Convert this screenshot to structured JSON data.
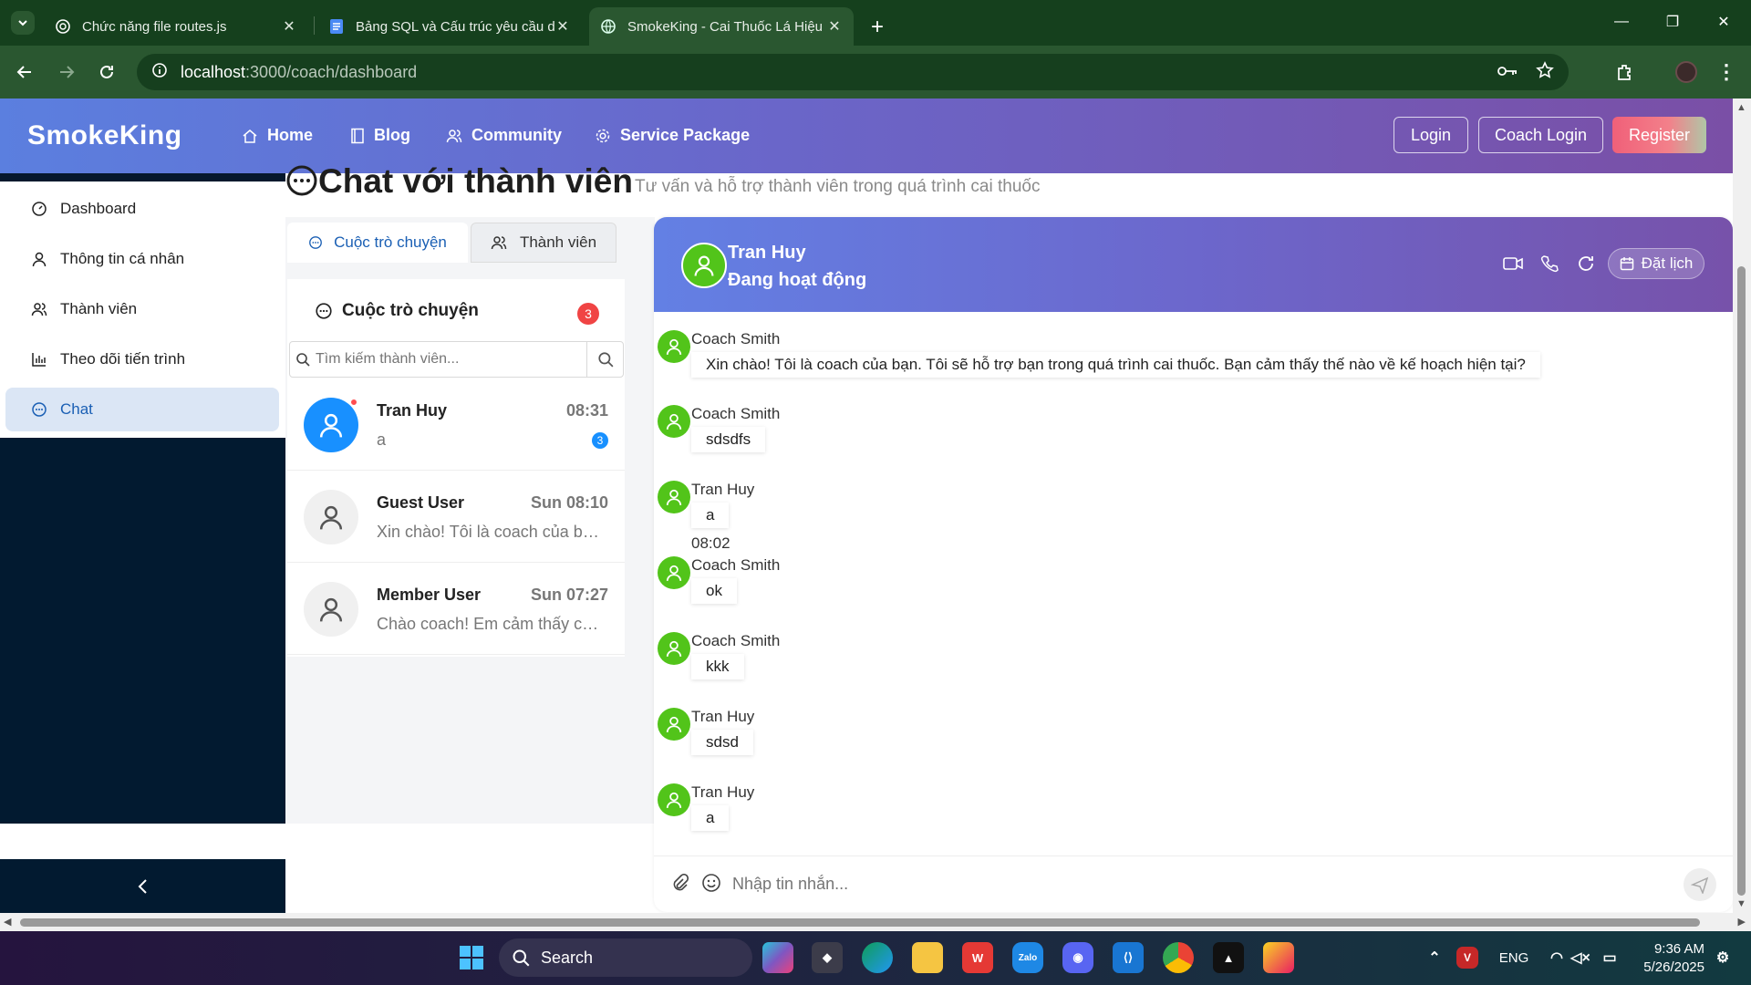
{
  "browser": {
    "tabs": [
      {
        "title": "Chức năng file routes.js",
        "icon": "chatgpt-icon"
      },
      {
        "title": "Bảng SQL và Cấu trúc yêu cầu dự án",
        "icon": "docs-icon"
      },
      {
        "title": "SmokeKing - Cai Thuốc Lá Hiệu Quả",
        "icon": "globe-icon",
        "active": true
      }
    ],
    "url_host": "localhost",
    "url_path": ":3000/coach/dashboard"
  },
  "site": {
    "brand": "SmokeKing",
    "nav": [
      {
        "label": "Home",
        "icon": "home-icon"
      },
      {
        "label": "Blog",
        "icon": "book-icon"
      },
      {
        "label": "Community",
        "icon": "team-icon"
      },
      {
        "label": "Service Package",
        "icon": "gear-icon"
      }
    ],
    "login": "Login",
    "coach_login": "Coach Login",
    "register": "Register"
  },
  "sidebar": {
    "items": [
      {
        "label": "Dashboard",
        "icon": "dashboard-icon"
      },
      {
        "label": "Thông tin cá nhân",
        "icon": "user-icon"
      },
      {
        "label": "Thành viên",
        "icon": "team-icon"
      },
      {
        "label": "Theo dõi tiến trình",
        "icon": "bar-chart-icon"
      },
      {
        "label": "Chat",
        "icon": "message-icon",
        "active": true
      }
    ],
    "collapse_icon": "chevron-left-icon"
  },
  "page": {
    "title": "Chat với thành viên",
    "subtitle": "Tư vấn và hỗ trợ thành viên trong quá trình cai thuốc"
  },
  "tabs": {
    "conversations": "Cuộc trò chuyện",
    "members": "Thành viên"
  },
  "conversations": {
    "header": "Cuộc trò chuyện",
    "badge": "3",
    "search_placeholder": "Tìm kiếm thành viên...",
    "items": [
      {
        "name": "Tran Huy",
        "time": "08:31",
        "preview": "a",
        "unread": "3",
        "online": true
      },
      {
        "name": "Guest User",
        "time": "Sun 08:10",
        "preview": "Xin chào! Tôi là coach của bạn. Tôi sẽ hỗ trợ bạn"
      },
      {
        "name": "Member User",
        "time": "Sun 07:27",
        "preview": "Chào coach! Em cảm thấy còn khó khăn"
      }
    ]
  },
  "chat": {
    "name": "Tran Huy",
    "status": "Đang hoạt động",
    "book_label": "Đặt lịch",
    "timestamp": "08:02",
    "messages": [
      {
        "sender": "Coach Smith",
        "text": "Xin chào! Tôi là coach của bạn. Tôi sẽ hỗ trợ bạn trong quá trình cai thuốc. Bạn cảm thấy thế nào về kế hoạch hiện tại?"
      },
      {
        "sender": "Coach Smith",
        "text": "sdsdfs"
      },
      {
        "sender": "Tran Huy",
        "text": "a"
      },
      {
        "sender": "Coach Smith",
        "text": "ok"
      },
      {
        "sender": "Coach Smith",
        "text": "kkk"
      },
      {
        "sender": "Tran Huy",
        "text": "sdsd"
      },
      {
        "sender": "Tran Huy",
        "text": "a"
      }
    ],
    "input_placeholder": "Nhập tin nhắn..."
  },
  "taskbar": {
    "search": "Search",
    "lang": "ENG",
    "time": "9:36 AM",
    "date": "5/26/2025"
  },
  "colors": {
    "accent": "#1a5fb4",
    "online": "#52c41a",
    "badge": "#f04444",
    "sidebar_dark": "#021a30"
  }
}
